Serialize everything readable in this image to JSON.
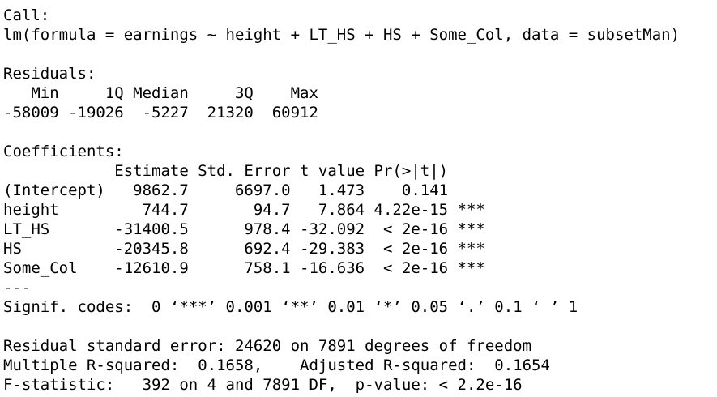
{
  "call": {
    "label": "Call:",
    "formula": "lm(formula = earnings ~ height + LT_HS + HS + Some_Col, data = subsetMan)"
  },
  "residuals": {
    "label": "Residuals:",
    "header": "   Min     1Q Median     3Q    Max ",
    "values": "-58009 -19026  -5227  21320  60912 "
  },
  "coefficients": {
    "label": "Coefficients:",
    "header": "            Estimate Std. Error t value Pr(>|t|)    ",
    "rows": [
      "(Intercept)   9862.7     6697.0   1.473    0.141    ",
      "height         744.7       94.7   7.864 4.22e-15 ***",
      "LT_HS       -31400.5      978.4 -32.092  < 2e-16 ***",
      "HS          -20345.8      692.4 -29.383  < 2e-16 ***",
      "Some_Col    -12610.9      758.1 -16.636  < 2e-16 ***"
    ],
    "separator": "---",
    "signif": "Signif. codes:  0 ‘***’ 0.001 ‘**’ 0.01 ‘*’ 0.05 ‘.’ 0.1 ‘ ’ 1"
  },
  "summary": {
    "rse": "Residual standard error: 24620 on 7891 degrees of freedom",
    "r_squared": "Multiple R-squared:  0.1658,\tAdjusted R-squared:  0.1654 ",
    "f_statistic": "F-statistic:   392 on 4 and 7891 DF,  p-value: < 2.2e-16"
  }
}
